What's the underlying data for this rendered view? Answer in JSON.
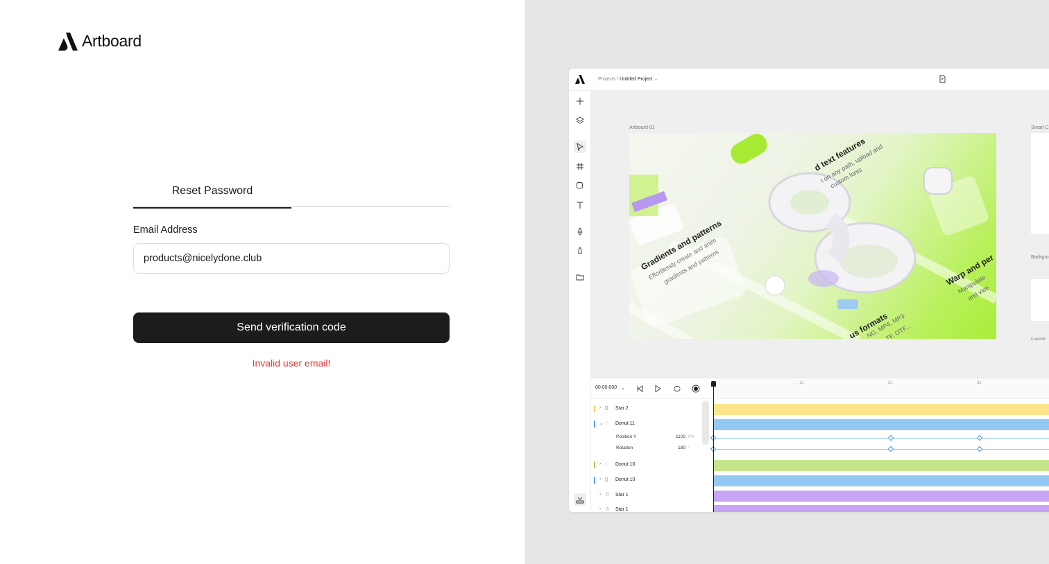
{
  "brand": {
    "name": "Artboard"
  },
  "auth": {
    "tab_label": "Reset Password",
    "email_label": "Email Address",
    "email_value": "products@nicelydone.club",
    "submit_label": "Send verification code",
    "error_message": "Invalid user email!",
    "error_color": "#e03a3a"
  },
  "preview": {
    "breadcrumb_root": "Projects /",
    "project_name": "Untitled Project",
    "artboard_label": "Artboard 01",
    "smart_label": "Smart C",
    "background_label": "Backgro",
    "vector_label": "s vector",
    "artboard_texts": {
      "gradients_title": "Gradients and patterns",
      "gradients_body_1": "Effortlessly create and anim",
      "gradients_body_2": "gradients and patterns",
      "text_title": "d text features",
      "text_body_1": "t on any path, upload and",
      "text_body_2": "custom fonts",
      "warp_title": "Warp and per",
      "warp_body_1": "Manipulate",
      "warp_body_2": "and vide",
      "formats_title": "us formats",
      "formats_body_1": "NG, MP4, MP3",
      "formats_body_2": "TF, OTF..."
    },
    "timeline": {
      "timecode": "00:00:000",
      "ruler_ticks": [
        "1s",
        "2s",
        "3s"
      ],
      "layers": [
        {
          "name": "Star 2",
          "color": "#f5d24b",
          "icon": "page-icon",
          "expanded": false
        },
        {
          "name": "Donut 11",
          "color": "#4aa8e8",
          "icon": "donut-icon",
          "expanded": true
        },
        {
          "name": "Donut 10",
          "color": "#a6d44a",
          "icon": "donut-icon",
          "expanded": false
        },
        {
          "name": "Donut 10",
          "color": "#4aa8e8",
          "icon": "page-icon",
          "expanded": false
        },
        {
          "name": "Star 1",
          "color": "",
          "icon": "star-icon",
          "expanded": false
        },
        {
          "name": "Star 1",
          "color": "",
          "icon": "star-icon",
          "expanded": false
        }
      ],
      "properties": [
        {
          "name": "Position Y",
          "value": "1102",
          "unit": "PX"
        },
        {
          "name": "Rotation",
          "value": "180",
          "unit": "°"
        }
      ],
      "track_colors": [
        "#fbe58a",
        "#94c8f4",
        "#c5e58a",
        "#94c8f4",
        "#c7a4f6",
        "#c7a4f6"
      ]
    }
  }
}
